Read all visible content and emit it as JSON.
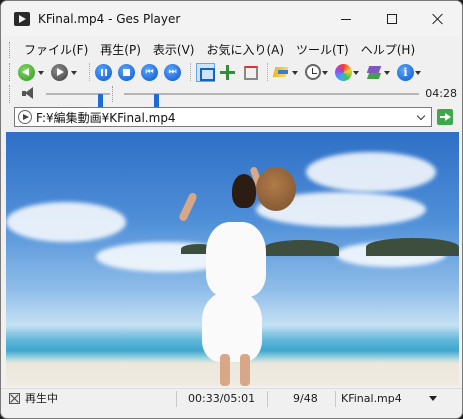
{
  "window": {
    "title": "KFinal.mp4 - Ges Player"
  },
  "menu": [
    "ファイル(F)",
    "再生(P)",
    "表示(V)",
    "お気に入り(A)",
    "ツール(T)",
    "ヘルプ(H)"
  ],
  "toolbar": {
    "icons": [
      "back-icon",
      "forward-icon",
      "pause-icon",
      "stop-icon",
      "previous-icon",
      "next-icon",
      "fit-window-icon",
      "move-icon",
      "pin-icon",
      "ab-repeat-icon",
      "clock-icon",
      "color-icon",
      "layers-icon",
      "info-icon"
    ],
    "info_glyph": "i"
  },
  "sliders": {
    "volume_level": 0.85,
    "seek_position": 0.11,
    "time": "04:28"
  },
  "address": {
    "value": "F:¥編集動画¥KFinal.mp4"
  },
  "status": {
    "state": "再生中",
    "time": "00:33/05:01",
    "track": "9/48",
    "file": "KFinal.mp4"
  },
  "colors": {
    "accent": "#1f6bd3",
    "go": "#3ea84a"
  }
}
